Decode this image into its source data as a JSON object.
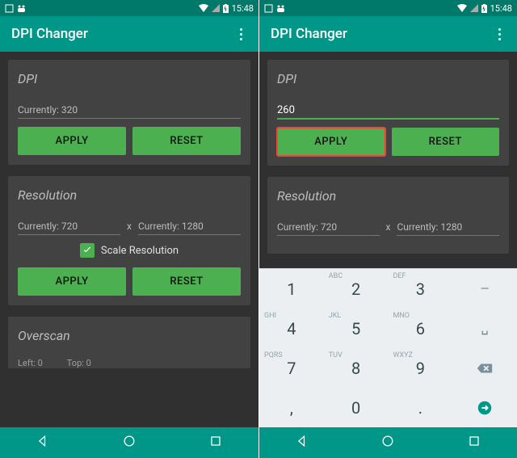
{
  "status": {
    "time": "15:48"
  },
  "appbar": {
    "title": "DPI Changer"
  },
  "left": {
    "dpi": {
      "title": "DPI",
      "placeholder": "Currently: 320",
      "apply": "APPLY",
      "reset": "RESET"
    },
    "resolution": {
      "title": "Resolution",
      "width_placeholder": "Currently: 720",
      "height_placeholder": "Currently: 1280",
      "x": "x",
      "scale_label": "Scale Resolution",
      "apply": "APPLY",
      "reset": "RESET"
    },
    "overscan": {
      "title": "Overscan",
      "left": "Left: 0",
      "top": "Top: 0"
    }
  },
  "right": {
    "dpi": {
      "title": "DPI",
      "value": "260",
      "apply": "APPLY",
      "reset": "RESET"
    },
    "resolution": {
      "title": "Resolution",
      "width_placeholder": "Currently: 720",
      "height_placeholder": "Currently: 1280",
      "x": "x"
    }
  },
  "keyboard": {
    "rows": [
      [
        "1",
        "2",
        "3",
        "-"
      ],
      [
        "4",
        "5",
        "6",
        "␣"
      ],
      [
        "7",
        "8",
        "9",
        "⌫"
      ],
      [
        ",",
        "0",
        ".",
        "✓"
      ]
    ],
    "subs": {
      "2": "ABC",
      "3": "DEF",
      "4": "GHI",
      "5": "JKL",
      "6": "MNO",
      "7": "PQRS",
      "8": "TUV",
      "9": "WXYZ"
    }
  }
}
